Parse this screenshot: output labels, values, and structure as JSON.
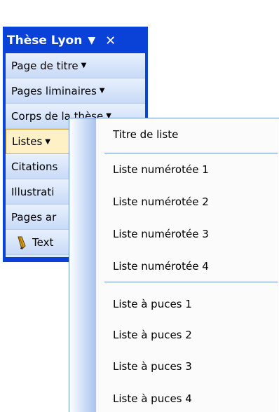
{
  "toolbar": {
    "title": "Thèse Lyon",
    "items": [
      {
        "label": "Page de titre",
        "arrow": "▼"
      },
      {
        "label": "Pages liminaires",
        "arrow": "▼"
      },
      {
        "label": "Corps de la thèse",
        "arrow": "▼"
      },
      {
        "label": "Listes",
        "arrow": "▼"
      },
      {
        "label": "Citations"
      },
      {
        "label": "Illustrati"
      },
      {
        "label": "Pages ar"
      },
      {
        "label": "Text"
      }
    ]
  },
  "submenu": {
    "items": [
      "Titre de liste",
      "Liste numérotée 1",
      "Liste numérotée 2",
      "Liste numérotée 3",
      "Liste numérotée 4",
      "Liste à puces 1",
      "Liste à puces 2",
      "Liste à puces 3",
      "Liste à puces 4"
    ]
  }
}
